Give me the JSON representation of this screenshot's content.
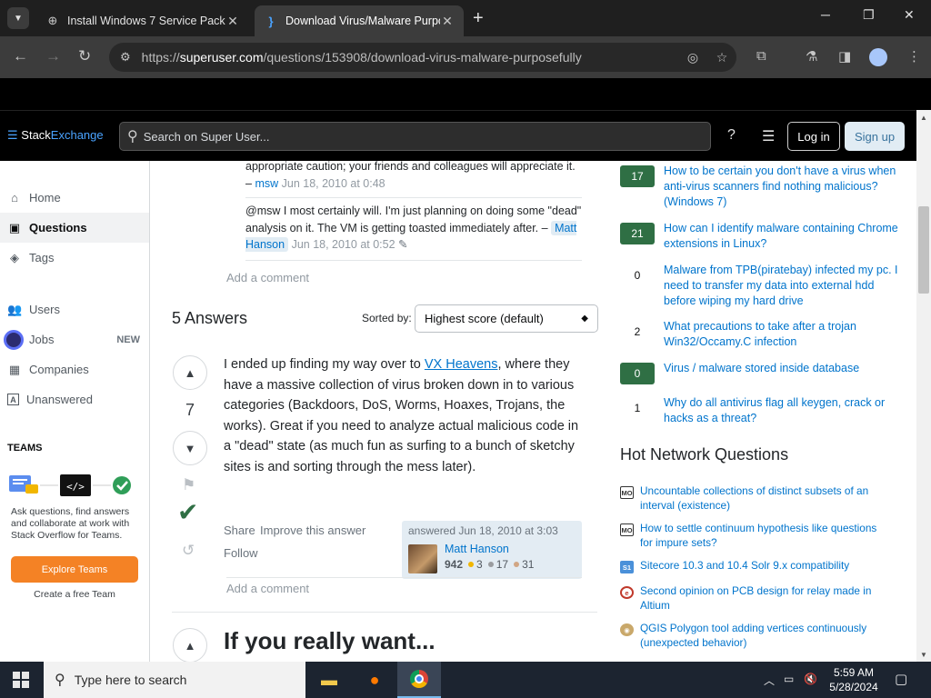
{
  "browser": {
    "tabs": [
      {
        "title": "Install Windows 7 Service Pack",
        "active": false
      },
      {
        "title": "Download Virus/Malware Purpo",
        "active": true
      }
    ],
    "url_host": "superuser.com",
    "url_prefix": "https://",
    "url_path": "/questions/153908/download-virus-malware-purposefully"
  },
  "header": {
    "logo_prefix": "Stack",
    "logo_suffix": "Exchange",
    "search_placeholder": "Search on Super User...",
    "login": "Log in",
    "signup": "Sign up"
  },
  "leftnav": {
    "items": [
      {
        "label": "Home"
      },
      {
        "label": "Questions"
      },
      {
        "label": "Tags"
      },
      {
        "label": "Users"
      },
      {
        "label": "Jobs",
        "badge": "NEW"
      },
      {
        "label": "Companies"
      },
      {
        "label": "Unanswered"
      }
    ],
    "teams_title": "TEAMS",
    "teams_desc": "Ask questions, find answers and collaborate at work with Stack Overflow for Teams.",
    "teams_button": "Explore Teams",
    "free_team": "Create a free Team"
  },
  "comments": [
    {
      "text": "appropriate caution; your friends and colleagues will appreciate it. – ",
      "user": "msw",
      "date": "Jun 18, 2010 at 0:48"
    },
    {
      "text": "@msw I most certainly will. I'm just planning on doing some \"dead\" analysis on it. The VM is getting toasted immediately after. – ",
      "user": "Matt Hanson",
      "date": "Jun 18, 2010 at 0:52"
    }
  ],
  "add_comment": "Add a comment",
  "answers": {
    "count_label": "5 Answers",
    "sorted_by": "Sorted by:",
    "sort_value": "Highest score (default)"
  },
  "answer": {
    "score": "7",
    "body_pre": "I ended up finding my way over to ",
    "link": "VX Heavens",
    "body_post": ", where they have a massive collection of virus broken down in to various categories (Backdoors, DoS, Worms, Hoaxes, Trojans, the works). Great if you need to analyze actual malicious code in a \"dead\" state (as much fun as surfing to a bunch of sketchy sites is and sorting through the mess later).",
    "share": "Share",
    "improve": "Improve this answer",
    "follow": "Follow",
    "answered": "answered Jun 18, 2010 at 3:03",
    "user": "Matt Hanson",
    "rep": "942",
    "gold": "3",
    "silver": "17",
    "bronze": "31"
  },
  "next_answer_heading": "If you really want...",
  "related": [
    {
      "score": "17",
      "accepted": true,
      "title": "How to be certain you don't have a virus when anti-virus scanners find nothing malicious? (Windows 7)"
    },
    {
      "score": "21",
      "accepted": true,
      "title": "How can I identify malware containing Chrome extensions in Linux?"
    },
    {
      "score": "0",
      "accepted": false,
      "title": "Malware from TPB(piratebay) infected my pc. I need to transfer my data into external hdd before wiping my hard drive"
    },
    {
      "score": "2",
      "accepted": false,
      "title": "What precautions to take after a trojan Win32/Occamy.C infection"
    },
    {
      "score": "0",
      "accepted": true,
      "title": "Virus / malware stored inside database"
    },
    {
      "score": "1",
      "accepted": false,
      "title": "Why do all antivirus flag all keygen, crack or hacks as a threat?"
    }
  ],
  "hnq_title": "Hot Network Questions",
  "hnq": [
    {
      "site": "mo",
      "title": "Uncountable collections of distinct subsets of an interval (existence)"
    },
    {
      "site": "mo",
      "title": "How to settle continuum hypothesis like questions for impure sets?"
    },
    {
      "site": "sitecore",
      "title": "Sitecore 10.3 and 10.4 Solr 9.x compatibility"
    },
    {
      "site": "electronics",
      "title": "Second opinion on PCB design for relay made in Altium"
    },
    {
      "site": "gis",
      "title": "QGIS Polygon tool adding vertices continuously (unexpected behavior)"
    }
  ],
  "taskbar": {
    "search_placeholder": "Type here to search",
    "time": "5:59 AM",
    "date": "5/28/2024"
  }
}
